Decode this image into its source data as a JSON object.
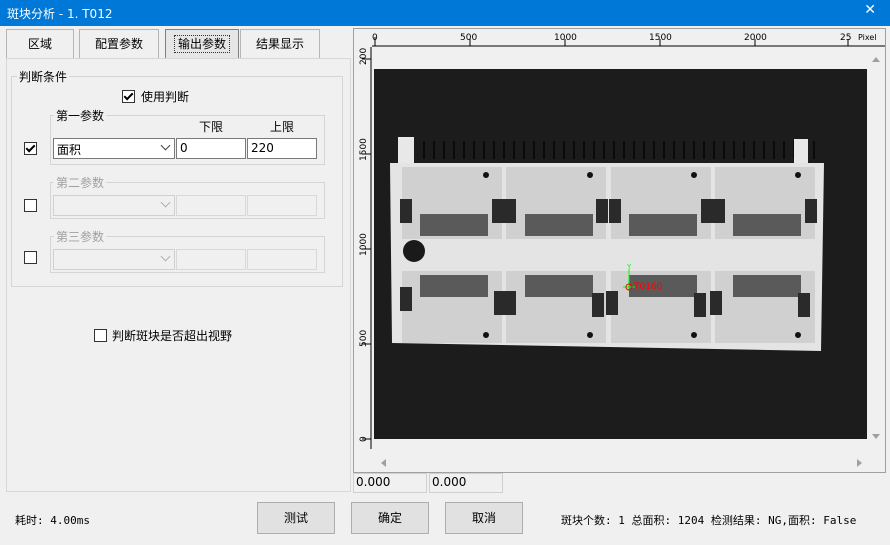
{
  "window": {
    "title": "斑块分析 - 1. T012",
    "close_glyph": "✕"
  },
  "tabs": [
    {
      "label": "区域"
    },
    {
      "label": "配置参数"
    },
    {
      "label": "输出参数"
    },
    {
      "label": "结果显示"
    }
  ],
  "judge": {
    "group_title": "判断条件",
    "use_label": "使用判断",
    "use_checked": true,
    "lower_label": "下限",
    "upper_label": "上限",
    "params": [
      {
        "title": "第一参数",
        "checked": true,
        "enabled": true,
        "selected": "面积",
        "lower": "0",
        "upper": "220"
      },
      {
        "title": "第二参数",
        "checked": false,
        "enabled": false,
        "selected": "",
        "lower": "",
        "upper": ""
      },
      {
        "title": "第三参数",
        "checked": false,
        "enabled": false,
        "selected": "",
        "lower": "",
        "upper": ""
      }
    ],
    "outside_label": "判断斑块是否超出视野",
    "outside_checked": false
  },
  "viewer": {
    "ruler_x_ticks": [
      "0",
      "500",
      "1000",
      "1500",
      "2000",
      "25"
    ],
    "ruler_unit": "Pixel",
    "ruler_y_ticks": [
      "200",
      "1500",
      "1000",
      "500",
      "0"
    ],
    "marker_label": "T0160",
    "coord_x": "0.000",
    "coord_y": "0.000"
  },
  "footer": {
    "elapsed": "耗时: 4.00ms",
    "test_button": "测试",
    "ok_button": "确定",
    "cancel_button": "取消",
    "result": "斑块个数: 1 总面积: 1204 检测结果: NG,面积: False"
  }
}
